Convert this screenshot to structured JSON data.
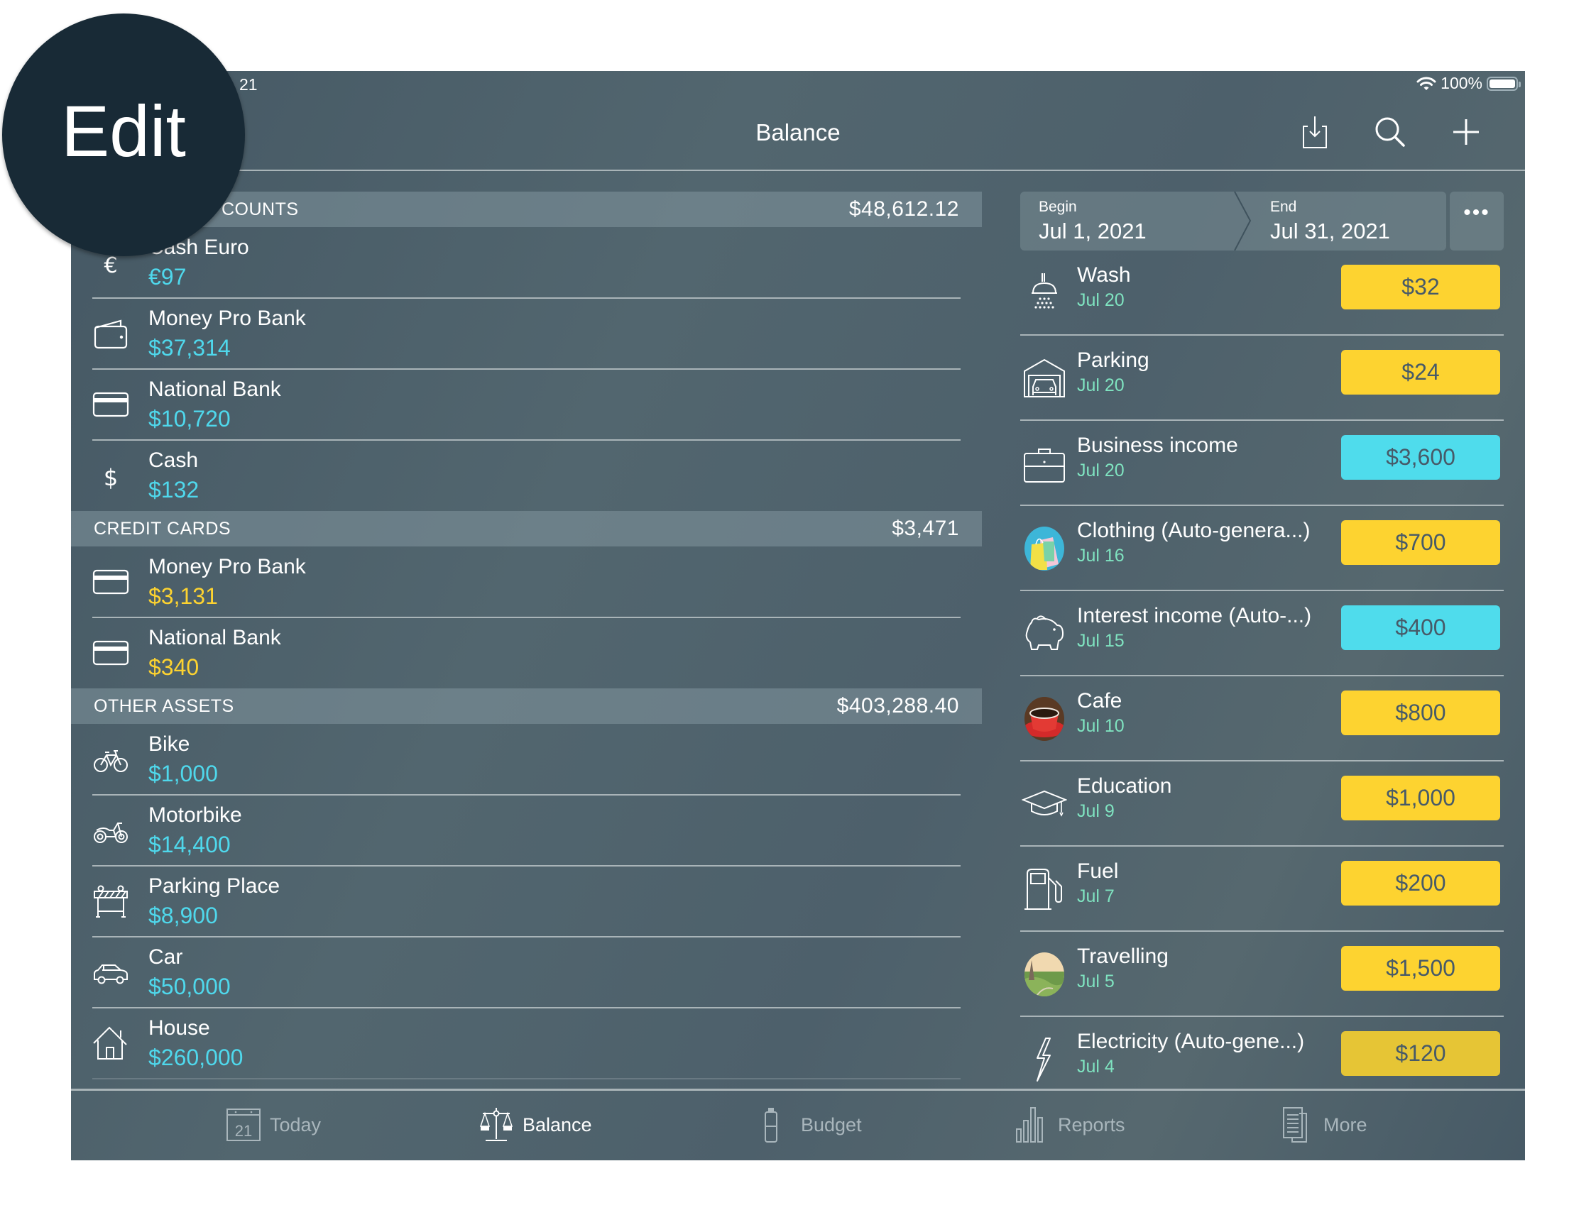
{
  "status_bar": {
    "time_fragment": "21",
    "battery": "100%"
  },
  "header": {
    "title": "Balance",
    "import_icon": "download-icon",
    "search_icon": "search-icon",
    "add_icon": "plus-icon"
  },
  "magnifier": {
    "label": "Edit"
  },
  "left_panel": {
    "sections": [
      {
        "title": "ACCOUNTS",
        "visible_title": "COUNTS",
        "total": "$48,612.12",
        "items": [
          {
            "name": "Cash Euro",
            "value": "€97",
            "icon": "euro-icon",
            "color": "cyan"
          },
          {
            "name": "Money Pro Bank",
            "value": "$37,314",
            "icon": "wallet-icon",
            "color": "cyan"
          },
          {
            "name": "National Bank",
            "value": "$10,720",
            "icon": "card-icon",
            "color": "cyan"
          },
          {
            "name": "Cash",
            "value": "$132",
            "icon": "dollar-icon",
            "color": "cyan"
          }
        ]
      },
      {
        "title": "CREDIT CARDS",
        "total": "$3,471",
        "items": [
          {
            "name": "Money Pro Bank",
            "value": "$3,131",
            "icon": "card-icon",
            "color": "yellow"
          },
          {
            "name": "National Bank",
            "value": "$340",
            "icon": "card-icon",
            "color": "yellow"
          }
        ]
      },
      {
        "title": "OTHER ASSETS",
        "total": "$403,288.40",
        "items": [
          {
            "name": "Bike",
            "value": "$1,000",
            "icon": "bicycle-icon",
            "color": "cyan"
          },
          {
            "name": "Motorbike",
            "value": "$14,400",
            "icon": "motorbike-icon",
            "color": "cyan"
          },
          {
            "name": "Parking Place",
            "value": "$8,900",
            "icon": "barrier-icon",
            "color": "cyan"
          },
          {
            "name": "Car",
            "value": "$50,000",
            "icon": "car-icon",
            "color": "cyan"
          },
          {
            "name": "House",
            "value": "$260,000",
            "icon": "house-icon",
            "color": "cyan"
          }
        ]
      }
    ]
  },
  "period": {
    "begin_label": "Begin",
    "begin_value": "Jul 1, 2021",
    "end_label": "End",
    "end_value": "Jul 31, 2021",
    "more_label": "•••"
  },
  "transactions": [
    {
      "name": "Wash",
      "date": "Jul 20",
      "amount": "$32",
      "type": "expense",
      "icon": "shower-icon"
    },
    {
      "name": "Parking",
      "date": "Jul 20",
      "amount": "$24",
      "type": "expense",
      "icon": "garage-icon"
    },
    {
      "name": "Business income",
      "date": "Jul 20",
      "amount": "$3,600",
      "type": "income",
      "icon": "briefcase-icon"
    },
    {
      "name": "Clothing (Auto-genera...)",
      "date": "Jul 16",
      "amount": "$700",
      "type": "expense",
      "icon": "shopping-bags-photo-icon"
    },
    {
      "name": "Interest income (Auto-...)",
      "date": "Jul 15",
      "amount": "$400",
      "type": "income",
      "icon": "piggy-bank-icon"
    },
    {
      "name": "Cafe",
      "date": "Jul 10",
      "amount": "$800",
      "type": "expense",
      "icon": "coffee-cup-photo-icon"
    },
    {
      "name": "Education",
      "date": "Jul 9",
      "amount": "$1,000",
      "type": "expense",
      "icon": "graduation-cap-icon"
    },
    {
      "name": "Fuel",
      "date": "Jul 7",
      "amount": "$200",
      "type": "expense",
      "icon": "fuel-pump-icon"
    },
    {
      "name": "Travelling",
      "date": "Jul 5",
      "amount": "$1,500",
      "type": "expense",
      "icon": "travel-photo-icon"
    },
    {
      "name": "Electricity (Auto-gene...)",
      "date": "Jul 4",
      "amount": "$120",
      "type": "expense",
      "icon": "lightning-icon"
    }
  ],
  "colors": {
    "expense": "#fdd330",
    "income": "#4fdcec",
    "positive_value": "#4fd8ec",
    "liability_value": "#fdd330",
    "date": "#7fe3c0"
  },
  "tabs": [
    {
      "label": "Today",
      "icon": "calendar-icon",
      "icon_text": "21",
      "active": false
    },
    {
      "label": "Balance",
      "icon": "scales-icon",
      "active": true
    },
    {
      "label": "Budget",
      "icon": "budget-icon",
      "active": false
    },
    {
      "label": "Reports",
      "icon": "bar-chart-icon",
      "active": false
    },
    {
      "label": "More",
      "icon": "documents-icon",
      "active": false
    }
  ]
}
